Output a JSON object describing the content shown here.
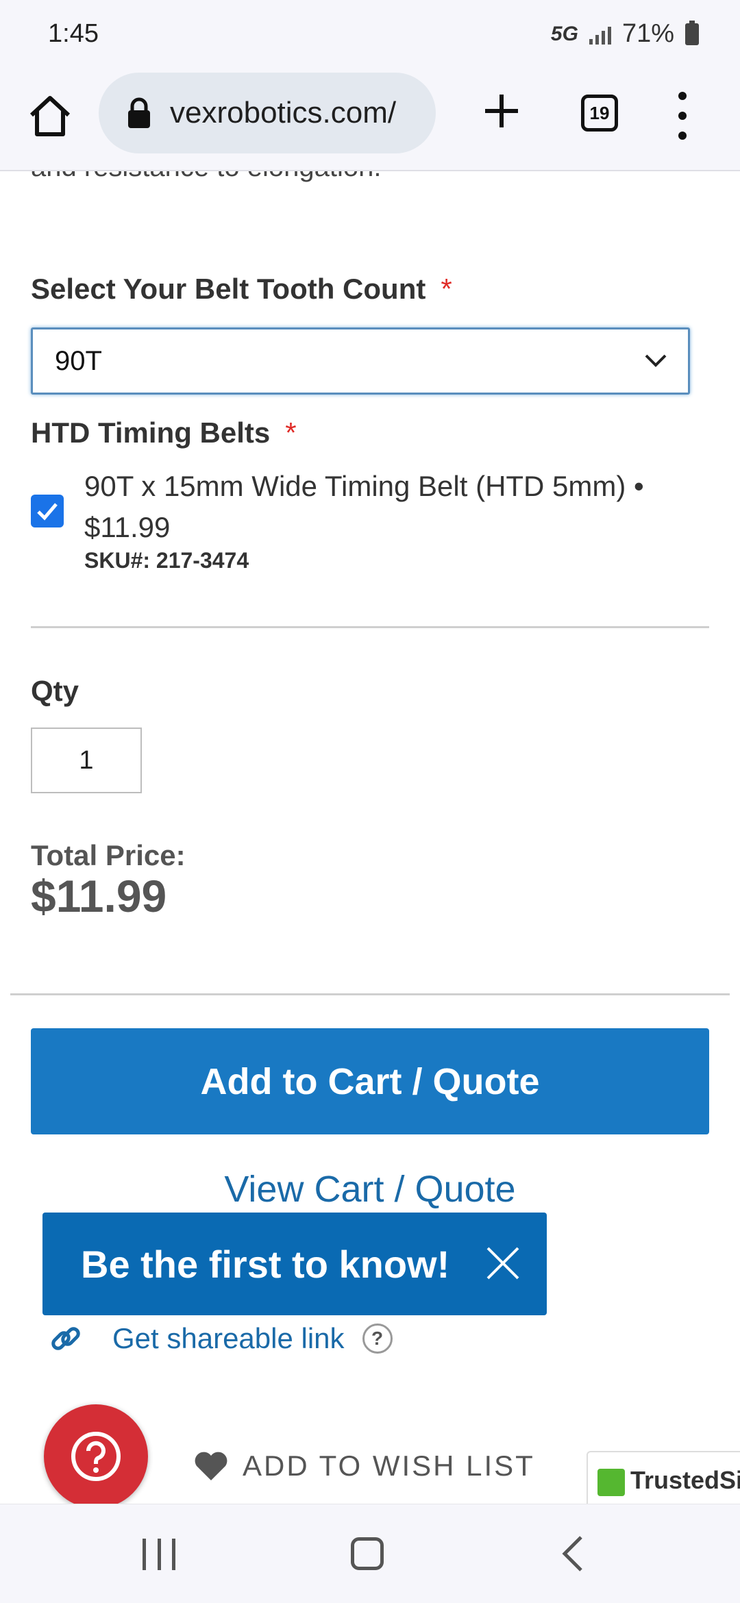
{
  "status_bar": {
    "time": "1:45",
    "network": "5G",
    "battery": "71%"
  },
  "browser": {
    "url": "vexrobotics.com/",
    "tab_count": "19"
  },
  "page": {
    "cut_text": "and resistance to elongation.",
    "tooth_count": {
      "label": "Select Your Belt Tooth Count",
      "required_mark": "*",
      "selected": "90T"
    },
    "belts": {
      "label": "HTD Timing Belts",
      "required_mark": "*",
      "option_text": "90T x 15mm Wide Timing Belt (HTD 5mm) • $11.99",
      "sku": "SKU#: 217-3474",
      "checked": true
    },
    "qty": {
      "label": "Qty",
      "value": "1"
    },
    "total": {
      "label": "Total Price:",
      "value": "$11.99"
    },
    "add_to_cart": "Add to Cart / Quote",
    "view_cart": "View Cart / Quote",
    "banner": {
      "text": "Be the first to know!"
    },
    "share": {
      "label": "Get shareable link",
      "help": "?"
    },
    "wishlist": "ADD TO WISH LIST",
    "trusted_badge": "TrustedSite"
  },
  "colors": {
    "primary_button": "#1979c3",
    "banner_bg": "#0a6ab3",
    "link": "#1a6aa8",
    "required": "#e02b27",
    "help_fab": "#d42e36",
    "checkbox": "#1a73e8"
  },
  "icons": [
    "home-icon",
    "lock-icon",
    "plus-icon",
    "tabs-icon",
    "more-vert-icon",
    "chevron-down-icon",
    "check-icon",
    "close-icon",
    "link-icon",
    "help-icon",
    "heart-icon",
    "recent-apps-icon",
    "home-nav-icon",
    "back-icon"
  ]
}
